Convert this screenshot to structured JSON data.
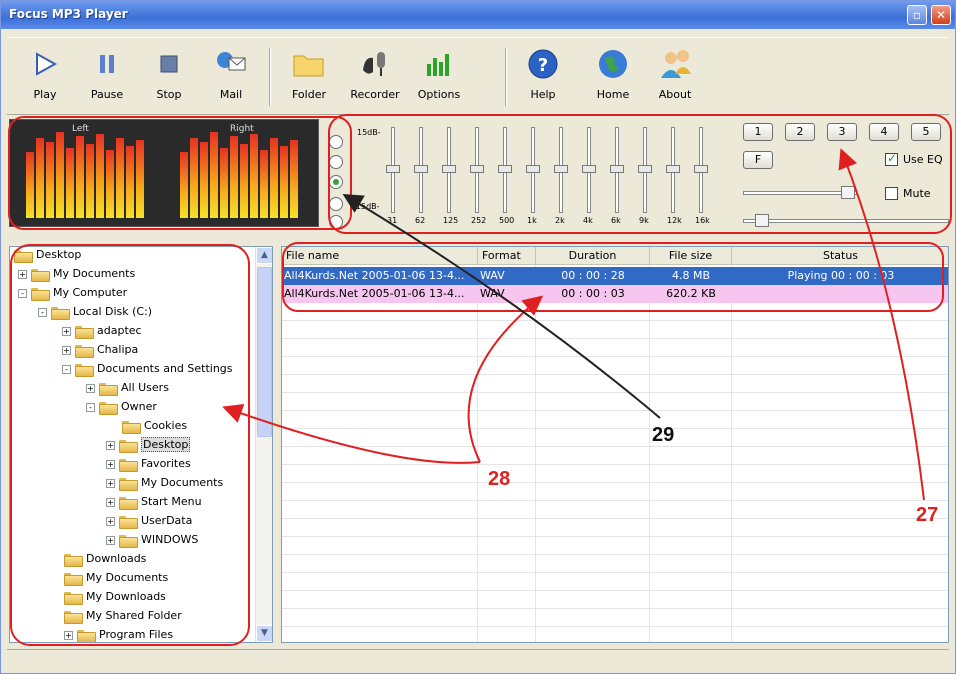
{
  "window": {
    "title": "Focus MP3 Player"
  },
  "toolbar": {
    "play": "Play",
    "pause": "Pause",
    "stop": "Stop",
    "mail": "Mail",
    "folder": "Folder",
    "recorder": "Recorder",
    "options": "Options",
    "help": "Help",
    "home": "Home",
    "about": "About"
  },
  "vu": {
    "left": "Left",
    "right": "Right"
  },
  "eq": {
    "db_top": "15dB-",
    "db_bottom": "-15dB-",
    "bands": [
      "31",
      "62",
      "125",
      "252",
      "500",
      "1k",
      "2k",
      "4k",
      "6k",
      "9k",
      "12k",
      "16k"
    ],
    "presets": [
      "1",
      "2",
      "3",
      "4",
      "5"
    ],
    "f_button": "F",
    "use_eq": "Use EQ",
    "mute": "Mute",
    "use_eq_checked": true,
    "mute_checked": false,
    "selected_radio": 2
  },
  "tree": {
    "items": [
      {
        "label": "Desktop"
      },
      {
        "label": "My Documents"
      },
      {
        "label": "My Computer"
      },
      {
        "label": "Local Disk (C:)"
      },
      {
        "label": "adaptec"
      },
      {
        "label": "Chalipa"
      },
      {
        "label": "Documents and Settings"
      },
      {
        "label": "All Users"
      },
      {
        "label": "Owner"
      },
      {
        "label": "Cookies"
      },
      {
        "label": "Desktop"
      },
      {
        "label": "Favorites"
      },
      {
        "label": "My Documents"
      },
      {
        "label": "Start Menu"
      },
      {
        "label": "UserData"
      },
      {
        "label": "WINDOWS"
      },
      {
        "label": "Downloads"
      },
      {
        "label": "My Documents"
      },
      {
        "label": "My Downloads"
      },
      {
        "label": "My Shared Folder"
      },
      {
        "label": "Program Files"
      }
    ]
  },
  "filelist": {
    "columns": [
      "File name",
      "Format",
      "Duration",
      "File size",
      "Status"
    ],
    "rows": [
      {
        "name": "All4Kurds.Net 2005-01-06 13-4...",
        "format": "WAV",
        "duration": "00 : 00 : 28",
        "size": "4.8 MB",
        "status": "Playing 00 : 00 : 03"
      },
      {
        "name": "All4Kurds.Net 2005-01-06 13-4...",
        "format": "WAV",
        "duration": "00 : 00 : 03",
        "size": "620.2 KB",
        "status": ""
      }
    ]
  },
  "callouts": {
    "c27": "27",
    "c28": "28",
    "c29": "29"
  },
  "colors": {
    "annotation": "#e02020",
    "selected_row": "#316ac5",
    "playing_row": "#f7c6f0"
  }
}
